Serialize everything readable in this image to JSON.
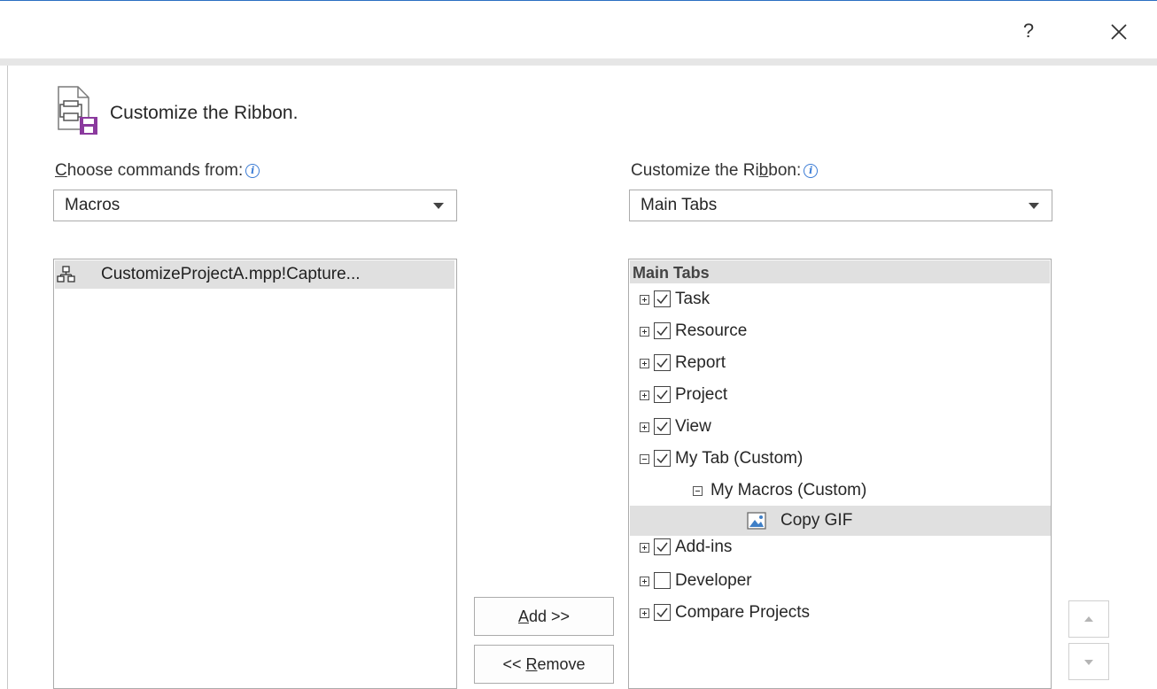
{
  "window": {
    "help_label": "?"
  },
  "header": {
    "title": "Customize the Ribbon."
  },
  "left": {
    "label_prefix": "C",
    "label_rest": "hoose commands from:",
    "select_value": "Macros",
    "items": [
      {
        "label": "CustomizeProjectA.mpp!Capture..."
      }
    ]
  },
  "right": {
    "label_prefix": "Customize the Ri",
    "label_accel": "b",
    "label_rest": "bon:",
    "select_value": "Main Tabs",
    "tree_header": "Main Tabs",
    "tree": [
      {
        "label": "Task",
        "expander": "plus",
        "checked": true
      },
      {
        "label": "Resource",
        "expander": "plus",
        "checked": true
      },
      {
        "label": "Report",
        "expander": "plus",
        "checked": true
      },
      {
        "label": "Project",
        "expander": "plus",
        "checked": true
      },
      {
        "label": "View",
        "expander": "plus",
        "checked": true
      },
      {
        "label": "My Tab (Custom)",
        "expander": "minus",
        "checked": true
      },
      {
        "label": "My Macros (Custom)",
        "expander": "minus"
      },
      {
        "label": "Copy GIF",
        "icon": "image-icon",
        "selected": true
      },
      {
        "label": "Add-ins",
        "expander": "plus",
        "checked": true
      },
      {
        "label": "Developer",
        "expander": "plus",
        "checked": false
      },
      {
        "label": "Compare Projects",
        "expander": "plus",
        "checked": true
      }
    ]
  },
  "buttons": {
    "add_accel": "A",
    "add_rest": "dd >>",
    "remove_prefix": "<< ",
    "remove_accel": "R",
    "remove_rest": "emove"
  },
  "info_glyph": "i",
  "colors": {
    "selection": "#e0e0e0",
    "accent": "#3a7bd5",
    "save_purple": "#8b3a9e"
  }
}
